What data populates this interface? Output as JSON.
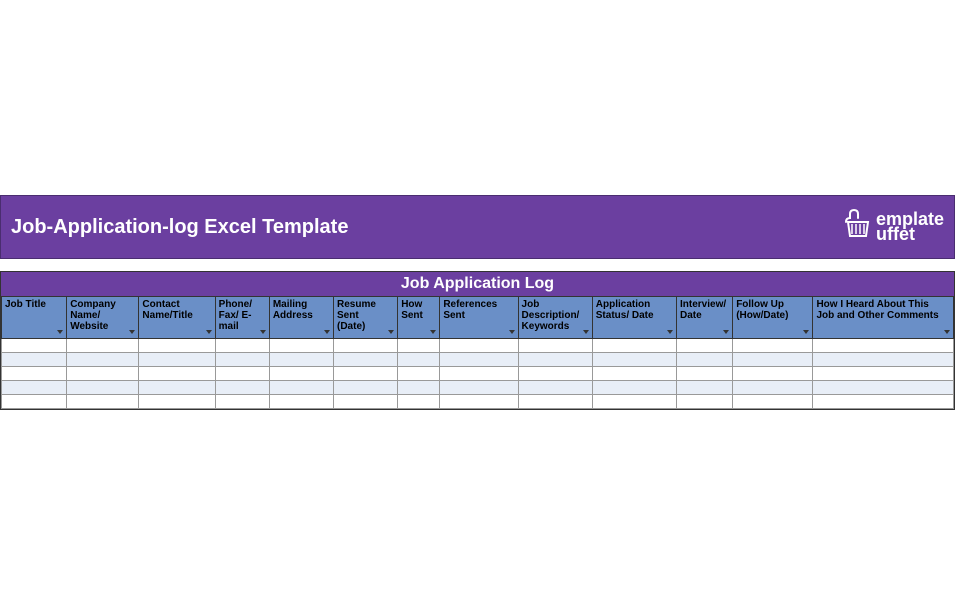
{
  "header": {
    "title": "Job-Application-log Excel Template",
    "logo_text": "emplate",
    "logo_text2": "uffet"
  },
  "sheet": {
    "title": "Job Application Log",
    "columns": [
      "Job Title",
      "Company Name/ Website",
      "Contact Name/Title",
      "Phone/ Fax/ E-mail",
      "Mailing Address",
      "Resume Sent (Date)",
      "How Sent",
      "References Sent",
      "Job Description/ Keywords",
      "Application Status/ Date",
      "Interview/ Date",
      "Follow Up (How/Date)",
      "How I Heard About This Job and Other Comments"
    ],
    "row_count": 5
  }
}
